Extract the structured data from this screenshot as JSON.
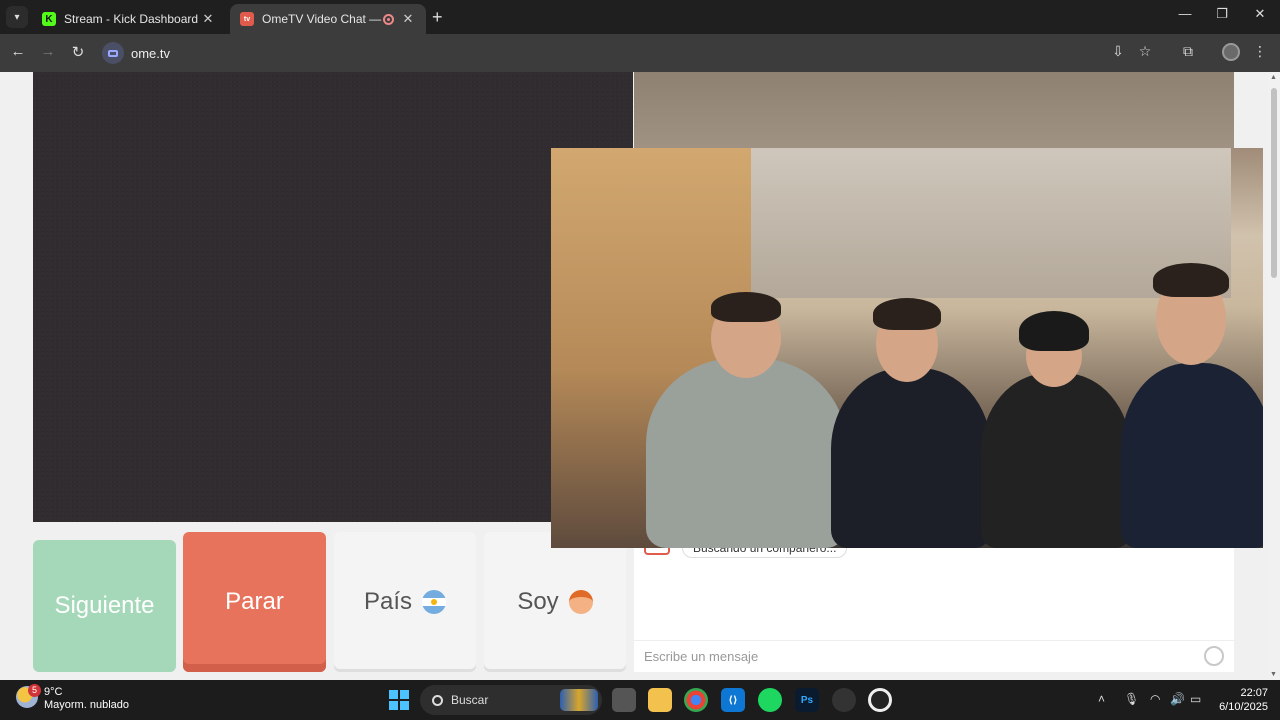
{
  "browser": {
    "tabs": [
      {
        "title": "Stream - Kick Dashboard",
        "favicon": "K",
        "active": false
      },
      {
        "title": "OmeTV Video Chat — Ome",
        "favicon": "tv",
        "active": true,
        "recording": true
      }
    ],
    "address": "ome.tv"
  },
  "page": {
    "buttons": {
      "next": "Siguiente",
      "stop": "Parar",
      "country": "País",
      "soy": "Soy"
    },
    "chat": {
      "status": "Buscando un compañero...",
      "placeholder": "Escribe un mensaje"
    }
  },
  "taskbar": {
    "weather_temp": "9°C",
    "weather_desc": "Mayorm. nublado",
    "weather_badge": "5",
    "search_label": "Buscar",
    "time": "22:07",
    "date": "6/10/2025"
  },
  "colors": {
    "next": "#a4d8b9",
    "stop": "#e8735d",
    "neutral": "#f4f4f4"
  }
}
